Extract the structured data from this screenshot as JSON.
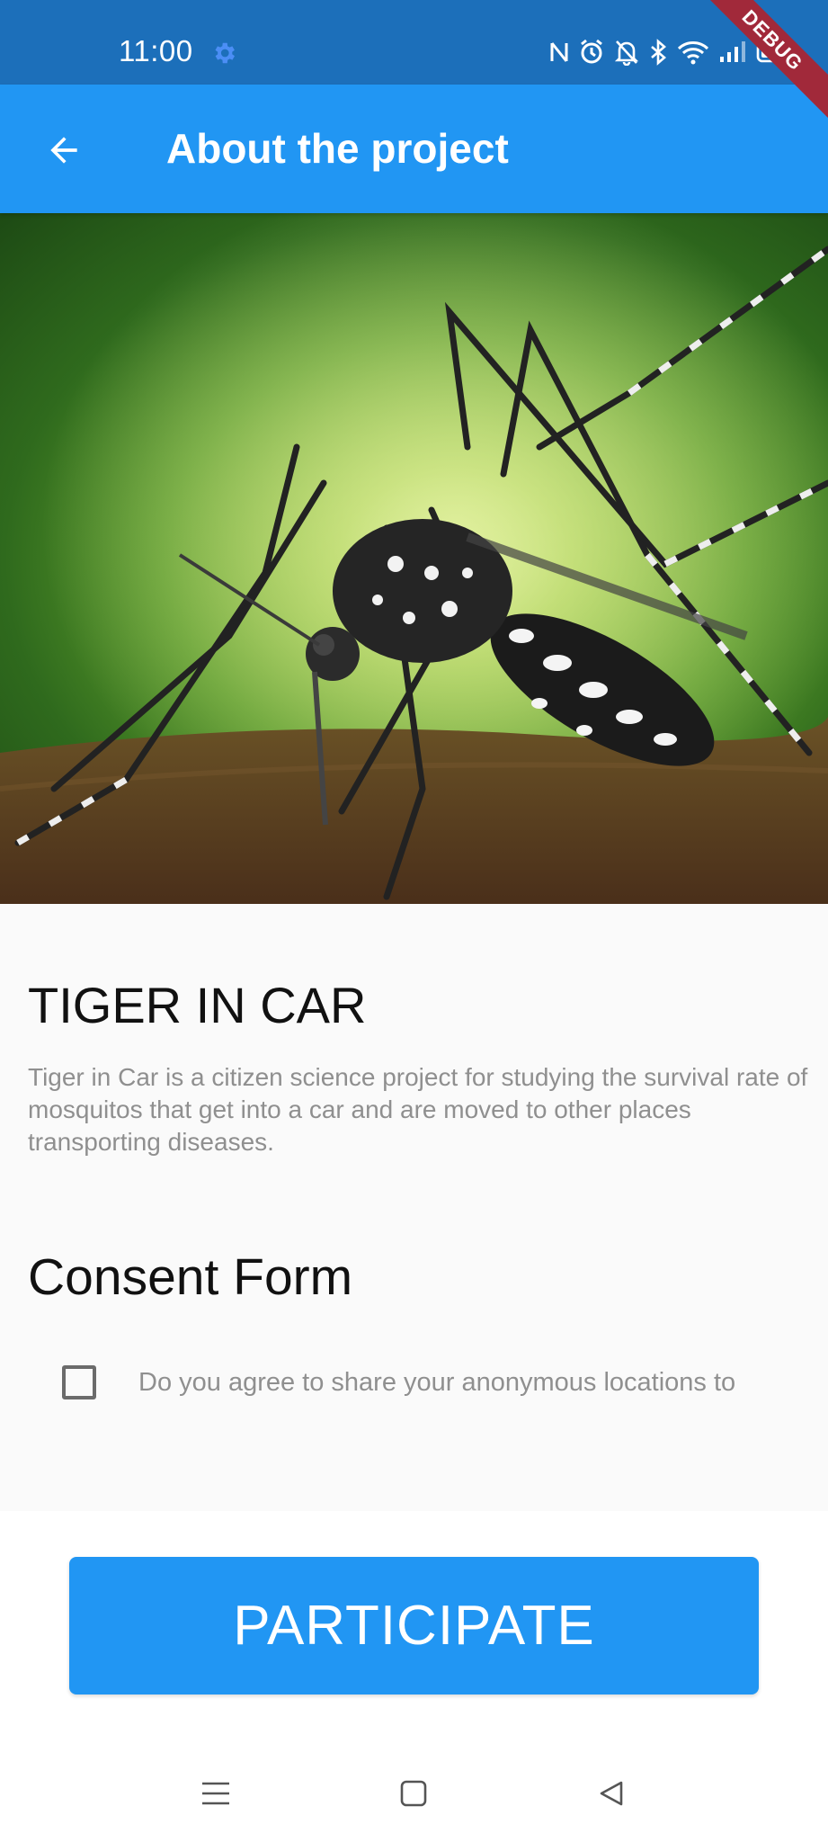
{
  "status_bar": {
    "time": "11:00",
    "icons": [
      "settings-gear-icon",
      "nfc-icon",
      "alarm-icon",
      "bell-off-icon",
      "bluetooth-icon",
      "wifi-icon",
      "signal-icon",
      "battery-icon"
    ]
  },
  "debug_banner": {
    "label": "DEBUG"
  },
  "app_bar": {
    "back_icon": "arrow-back-icon",
    "title": "About the project",
    "color": "#2196f3"
  },
  "hero": {
    "image": "mosquito-photo"
  },
  "content": {
    "title": "TIGER IN CAR",
    "description": "Tiger in Car is a citizen science project for studying the survival rate of mosquitos that get into a car and are moved to other places transporting diseases.",
    "consent_title": "Consent Form",
    "consent_checkbox": {
      "checked": false,
      "label": "Do you agree to share your anonymous locations to"
    }
  },
  "actions": {
    "participate_label": "PARTICIPATE"
  },
  "nav_bar": {
    "items": [
      "menu-icon",
      "home-square-icon",
      "back-triangle-icon"
    ]
  }
}
